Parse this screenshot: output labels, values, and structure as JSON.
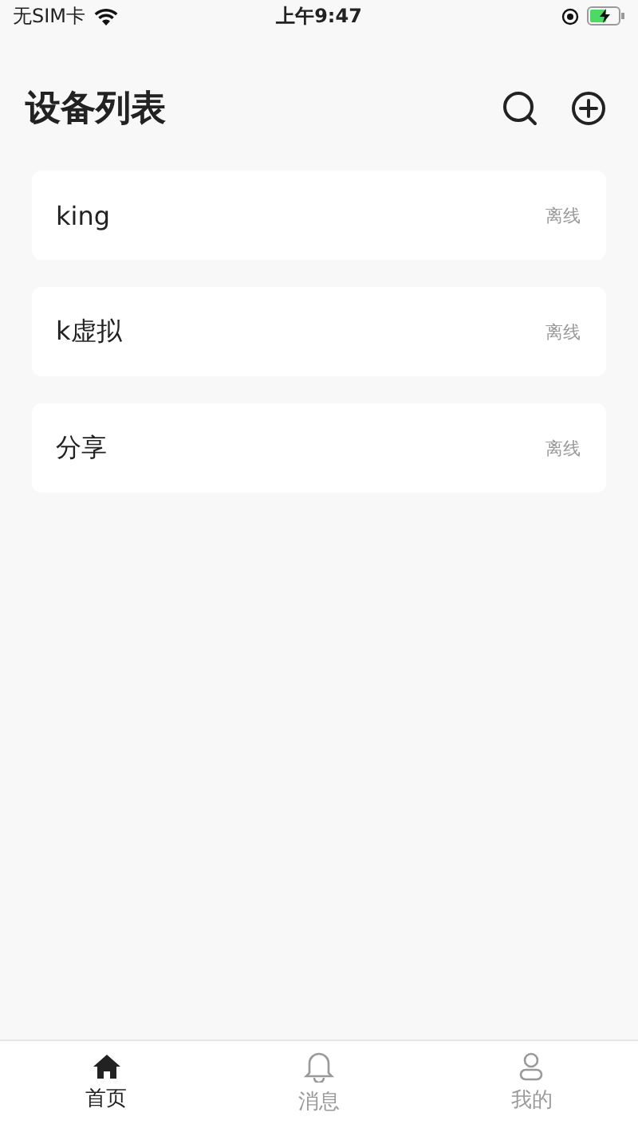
{
  "status_bar": {
    "carrier": "无SIM卡",
    "time": "上午9:47"
  },
  "header": {
    "title": "设备列表"
  },
  "devices": [
    {
      "name": "king",
      "status": "离线"
    },
    {
      "name": "k虚拟",
      "status": "离线"
    },
    {
      "name": "分享",
      "status": "离线"
    }
  ],
  "tabs": [
    {
      "kind": "home",
      "label": "首页",
      "selected": true
    },
    {
      "kind": "bell",
      "label": "消息",
      "selected": false
    },
    {
      "kind": "person",
      "label": "我的",
      "selected": false
    }
  ]
}
